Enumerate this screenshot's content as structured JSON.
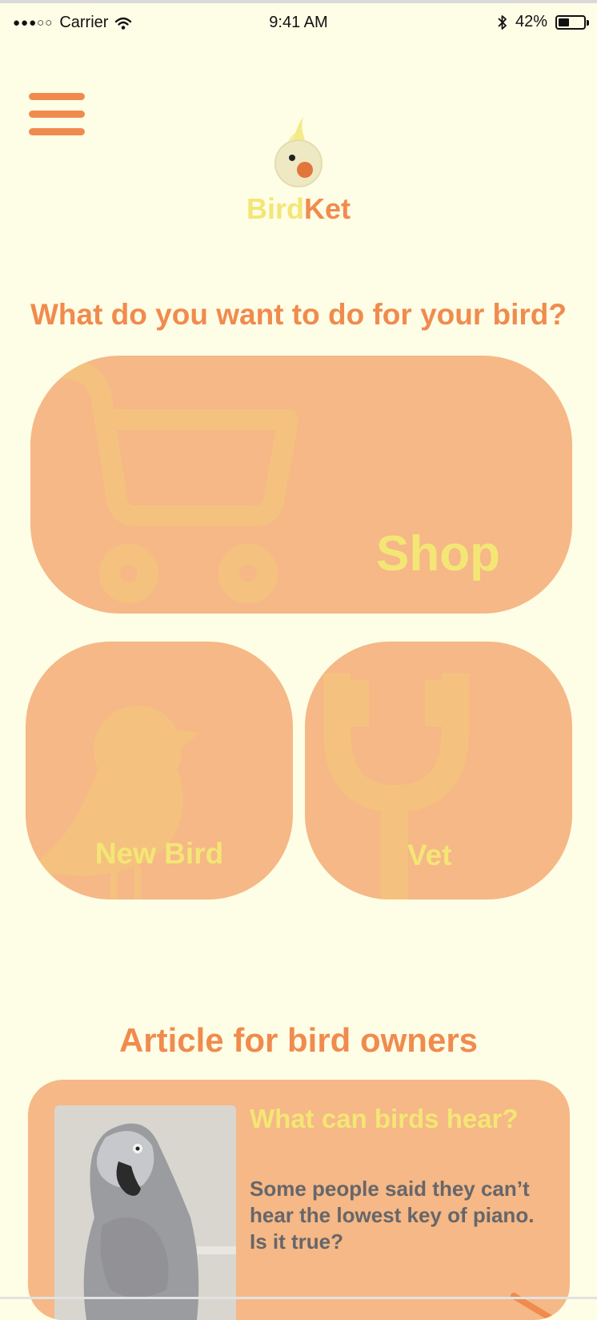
{
  "status_bar": {
    "signal_dots": "●●●○○",
    "carrier": "Carrier",
    "time": "9:41 AM",
    "battery_percent": "42%",
    "battery_level": 0.42
  },
  "brand": {
    "name_part1": "Bird",
    "name_part2": "Ket",
    "color_yellow": "#F4E675",
    "color_orange": "#F08B4E"
  },
  "main": {
    "heading": "What do you want to do for your bird?",
    "tiles": [
      {
        "label": "Shop",
        "icon": "shopping-cart-icon"
      },
      {
        "label": "New Bird",
        "icon": "bird-icon"
      },
      {
        "label": "Vet",
        "icon": "stethoscope-icon"
      }
    ]
  },
  "articles": {
    "heading": "Article for bird owners",
    "items": [
      {
        "title": "What can birds hear?",
        "excerpt": "Some people said they can’t hear the lowest key of piano. Is it true?",
        "image": "grey-parrot-photo"
      }
    ]
  }
}
